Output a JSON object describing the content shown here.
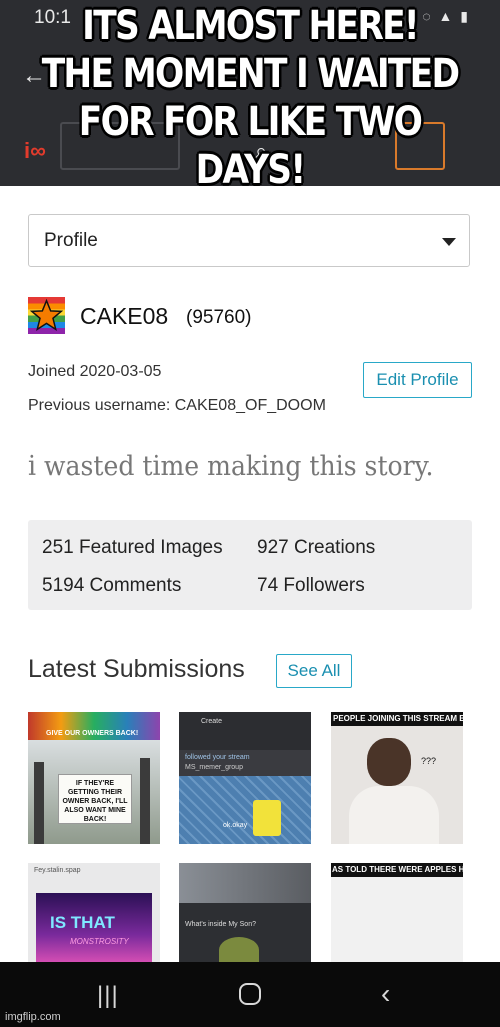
{
  "meme_caption": [
    "ITS ALMOST HERE!",
    "THE MOMENT I WAITED",
    "FOR FOR LIKE TWO DAYS!"
  ],
  "status_bar": {
    "time": "10:1"
  },
  "profile_dropdown": {
    "selected": "Profile"
  },
  "profile": {
    "username": "CAKE08",
    "points": "(95760)",
    "joined": "Joined 2020-03-05",
    "previous_username": "Previous username: CAKE08_OF_DOOM",
    "edit_label": "Edit Profile",
    "bio": "i wasted time making this story."
  },
  "stats": [
    "251 Featured Images",
    "927 Creations",
    "5194 Comments",
    "74 Followers"
  ],
  "latest": {
    "title": "Latest Submissions",
    "see_all_label": "See All",
    "thumbnails": [
      {
        "caption": "IF THEY'RE GETTING THEIR OWNER BACK, I'LL ALSO WANT MINE BACK!",
        "top": "GIVE OUR OWNERS BACK!"
      },
      {
        "caption": "ok.okay",
        "line1": "Create",
        "line2": "followed your stream",
        "line3": "MS_memer_group"
      },
      {
        "caption": "PEOPLE JOINING THIS STREAM B",
        "marks": "???"
      },
      {
        "caption": "IS THAT",
        "sub": "MONSTROSITY",
        "line1": "Fey.stalin.spap"
      },
      {
        "caption": "What's inside My Son?"
      },
      {
        "caption": "AS TOLD THERE WERE APPLES H"
      }
    ]
  },
  "watermark": "imgflip.com",
  "colors": {
    "accent": "#29a8c8",
    "topbar": "#2c2d31",
    "stats_bg": "#eeeeef"
  }
}
